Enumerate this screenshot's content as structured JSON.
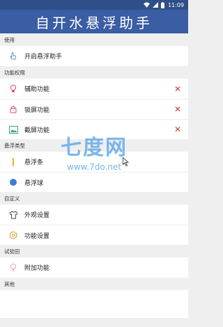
{
  "status_bar": {
    "time": "11:09"
  },
  "app_title": "自开水悬浮助手",
  "sections": [
    {
      "header": "使用",
      "items": [
        {
          "label": "开启悬浮助手",
          "icon": "hand-pointer-icon"
        }
      ]
    },
    {
      "header": "功能权限",
      "items": [
        {
          "label": "辅助功能",
          "icon": "bulb-icon"
        },
        {
          "label": "锁屏功能",
          "icon": "lock-icon"
        },
        {
          "label": "截屏功能",
          "icon": "image-icon"
        }
      ]
    },
    {
      "header": "悬浮类型",
      "items": [
        {
          "label": "悬浮条",
          "icon": "bar-icon"
        },
        {
          "label": "悬浮球",
          "icon": "ball-icon"
        }
      ]
    },
    {
      "header": "自定义",
      "items": [
        {
          "label": "外观设置",
          "icon": "shirt-icon"
        },
        {
          "label": "功能设置",
          "icon": "gear-icon"
        }
      ]
    },
    {
      "header": "试验田",
      "items": [
        {
          "label": "附加功能",
          "icon": "bulb-outline-icon"
        }
      ]
    },
    {
      "header": "其他",
      "items": []
    }
  ],
  "watermark": {
    "big": "七度网",
    "url": "www.7do.net"
  },
  "colors": {
    "primary": "#3a5da4",
    "status_bar": "#2f4f88",
    "close": "#d3383a",
    "background": "#efefef"
  }
}
